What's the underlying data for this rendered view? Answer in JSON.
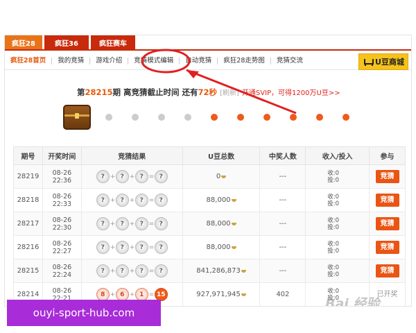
{
  "tabs": [
    "疯狂28",
    "疯狂36",
    "疯狂赛车"
  ],
  "nav": {
    "items": [
      "疯狂28首页",
      "我的竞猜",
      "游戏介绍",
      "竞猜模式编辑",
      "自动竞猜",
      "疯狂28走势图",
      "竞猜交流"
    ],
    "shop_label": "U豆商城"
  },
  "countdown": {
    "prefix": "第",
    "period": "28215",
    "mid": "期  离竞猜截止时间  还有",
    "seconds": "72秒",
    "refresh": "[刷新]",
    "svip": "开通SVIP，可得1200万U豆>>"
  },
  "table": {
    "headers": [
      "期号",
      "开奖时间",
      "竞猜结果",
      "U豆总数",
      "中奖人数",
      "收入/投入",
      "参与"
    ],
    "rows": [
      {
        "no": "28219",
        "date": "08-26",
        "time": "22:36",
        "balls": [
          "?",
          "?",
          "?",
          "?"
        ],
        "total": "0",
        "winners": "---",
        "income": "收:0",
        "invest": "投:0",
        "action": "竞猜"
      },
      {
        "no": "28218",
        "date": "08-26",
        "time": "22:33",
        "balls": [
          "?",
          "?",
          "?",
          "?"
        ],
        "total": "88,000",
        "winners": "---",
        "income": "收:0",
        "invest": "投:0",
        "action": "竞猜"
      },
      {
        "no": "28217",
        "date": "08-26",
        "time": "22:30",
        "balls": [
          "?",
          "?",
          "?",
          "?"
        ],
        "total": "88,000",
        "winners": "---",
        "income": "收:0",
        "invest": "投:0",
        "action": "竞猜"
      },
      {
        "no": "28216",
        "date": "08-26",
        "time": "22:27",
        "balls": [
          "?",
          "?",
          "?",
          "?"
        ],
        "total": "88,000",
        "winners": "---",
        "income": "收:0",
        "invest": "投:0",
        "action": "竞猜"
      },
      {
        "no": "28215",
        "date": "08-26",
        "time": "22:24",
        "balls": [
          "?",
          "?",
          "?",
          "?"
        ],
        "total": "841,286,873",
        "winners": "---",
        "income": "收:0",
        "invest": "投:0",
        "action": "竞猜"
      },
      {
        "no": "28214",
        "date": "08-26",
        "time": "22:21",
        "balls": [
          "8",
          "6",
          "1",
          "15"
        ],
        "total": "927,971,945",
        "winners": "402",
        "income": "收:0",
        "invest": "投:0",
        "action": "已开奖"
      }
    ]
  },
  "watermark": "Bai 经验",
  "domain_banner": "ouyi-sport-hub.com",
  "colors": {
    "brand": "#c82a0c",
    "accent": "#f05a1a",
    "shop": "#f6c21b",
    "banner": "#a82cd8"
  }
}
